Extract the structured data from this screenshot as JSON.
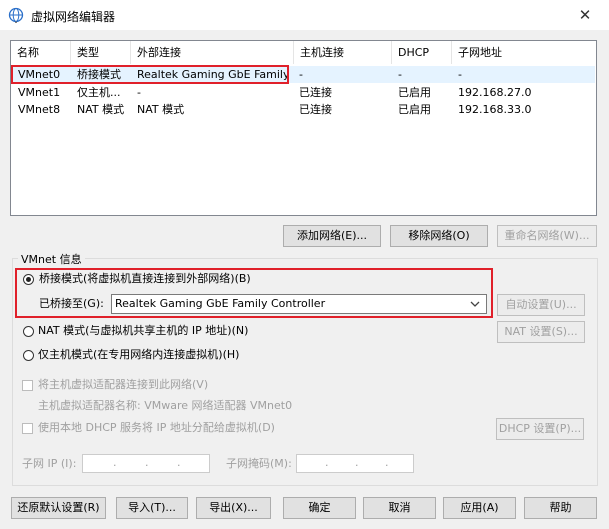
{
  "window": {
    "title": "虚拟网络编辑器",
    "close_glyph": "✕",
    "icon": "globe-icon"
  },
  "table": {
    "columns": [
      "名称",
      "类型",
      "外部连接",
      "主机连接",
      "DHCP",
      "子网地址"
    ],
    "rows": [
      {
        "name": "VMnet0",
        "type": "桥接模式",
        "external": "Realtek Gaming GbE Family ...",
        "host": "-",
        "dhcp": "-",
        "subnet": "-"
      },
      {
        "name": "VMnet1",
        "type": "仅主机...",
        "external": "-",
        "host": "已连接",
        "dhcp": "已启用",
        "subnet": "192.168.27.0"
      },
      {
        "name": "VMnet8",
        "type": "NAT 模式",
        "external": "NAT 模式",
        "host": "已连接",
        "dhcp": "已启用",
        "subnet": "192.168.33.0"
      }
    ]
  },
  "list_buttons": {
    "add": "添加网络(E)...",
    "remove": "移除网络(O)",
    "rename": "重命名网络(W)..."
  },
  "vmnet_info": {
    "group_title": "VMnet 信息",
    "bridged_label": "桥接模式(将虚拟机直接连接到外部网络)(B)",
    "bridged_to_label": "已桥接至(G):",
    "bridged_to_value": "Realtek Gaming GbE Family Controller",
    "auto_settings": "自动设置(U)...",
    "nat_label": "NAT 模式(与虚拟机共享主机的 IP 地址)(N)",
    "nat_settings": "NAT 设置(S)...",
    "host_only_label": "仅主机模式(在专用网络内连接虚拟机)(H)",
    "connect_adapter_label": "将主机虚拟适配器连接到此网络(V)",
    "adapter_name_label": "主机虚拟适配器名称: VMware 网络适配器 VMnet0",
    "dhcp_label": "使用本地 DHCP 服务将 IP 地址分配给虚拟机(D)",
    "dhcp_settings": "DHCP 设置(P)...",
    "subnet_ip_label": "子网 IP (I):",
    "subnet_mask_label": "子网掩码(M):",
    "selected_mode": "bridged"
  },
  "footer": {
    "restore": "还原默认设置(R)",
    "import": "导入(T)...",
    "export": "导出(X)...",
    "ok": "确定",
    "cancel": "取消",
    "apply": "应用(A)",
    "help": "帮助"
  },
  "colors": {
    "highlight_red": "#e0202a",
    "selected_row": "#e5f3ff"
  }
}
